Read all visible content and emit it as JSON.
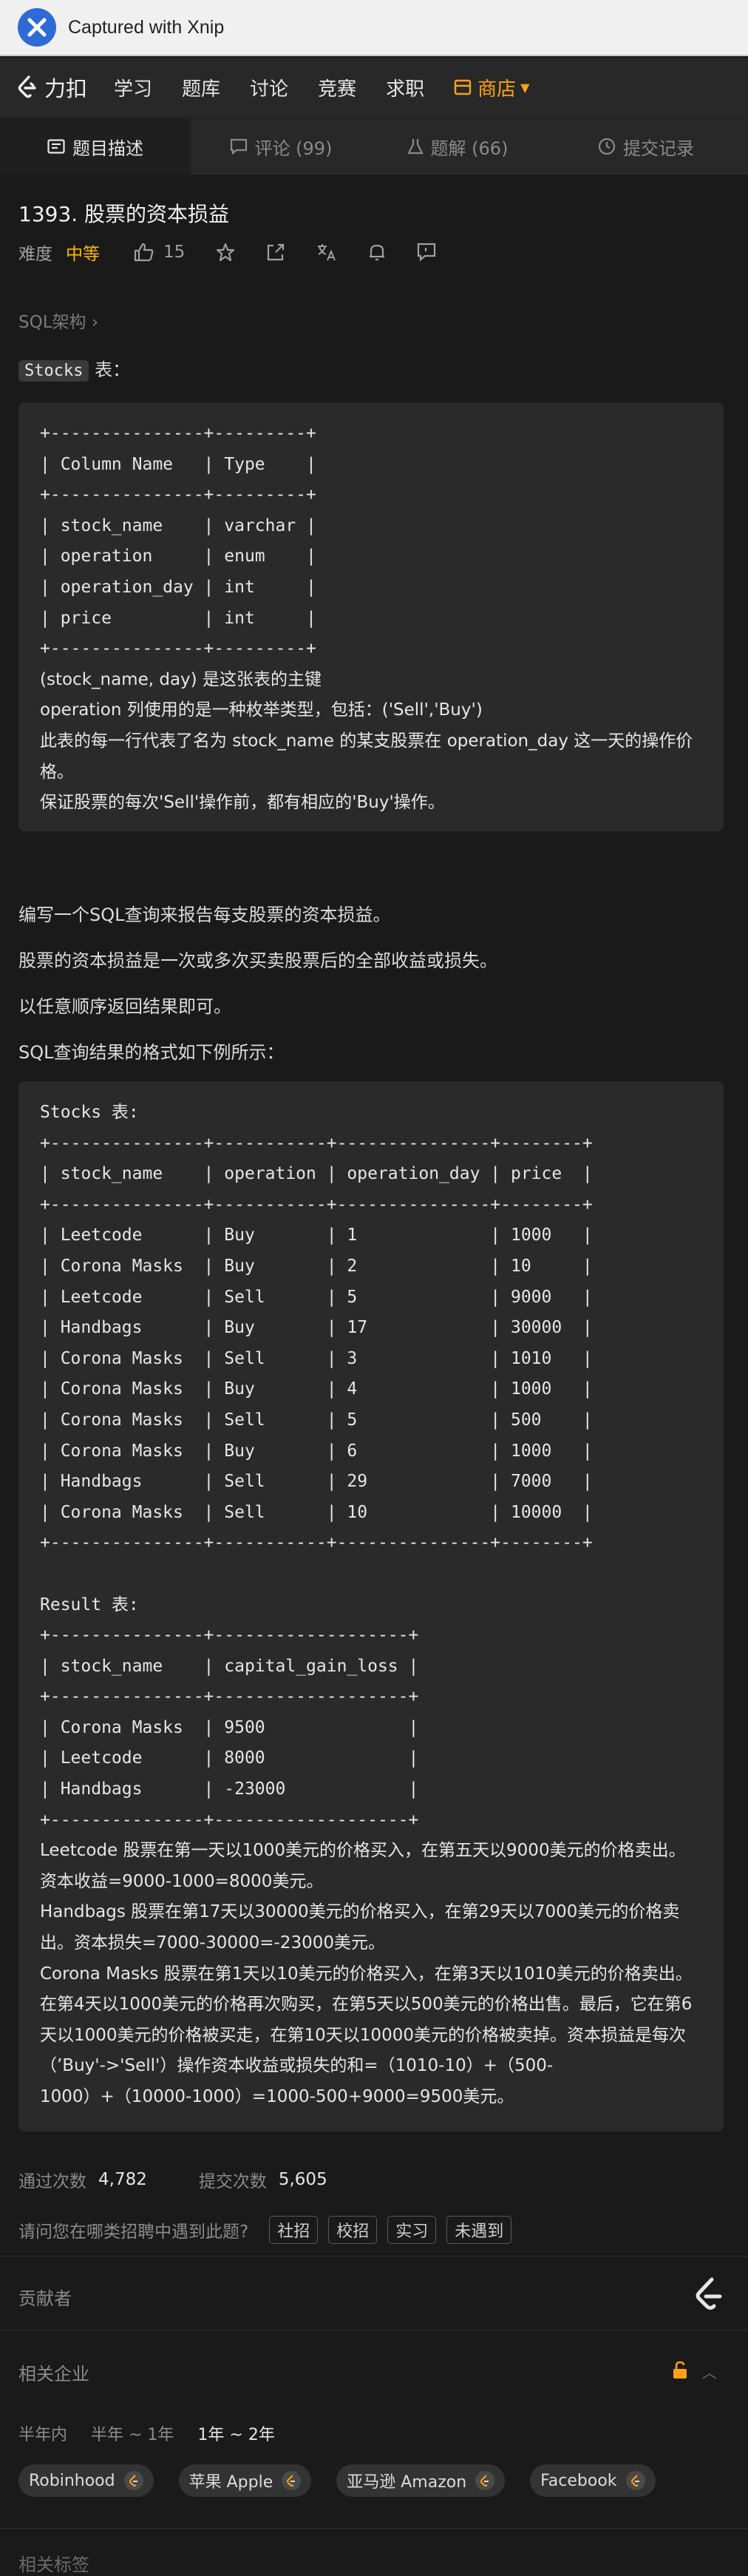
{
  "titlebar": {
    "title": "Captured with Xnip"
  },
  "nav": {
    "brand": "力扣",
    "items": [
      "学习",
      "题库",
      "讨论",
      "竞赛",
      "求职"
    ],
    "store": "商店"
  },
  "tabs": [
    {
      "label": "题目描述",
      "active": true
    },
    {
      "label": "评论 (99)",
      "active": false
    },
    {
      "label": "题解 (66)",
      "active": false
    },
    {
      "label": "提交记录",
      "active": false
    }
  ],
  "problem": {
    "title": "1393. 股票的资本损益",
    "difficulty_label": "难度",
    "difficulty": "中等",
    "likes": "15",
    "breadcrumb": "SQL架构 ›",
    "table_name": "Stocks",
    "table_suffix": " 表：",
    "schema_pre": "+---------------+---------+\n| Column Name   | Type    |\n+---------------+---------+\n| stock_name    | varchar |\n| operation     | enum    |\n| operation_day | int     |\n| price         | int     |\n+---------------+---------+",
    "schema_notes": [
      "(stock_name, day) 是这张表的主键",
      "operation 列使用的是一种枚举类型，包括：('Sell','Buy')",
      "此表的每一行代表了名为 stock_name 的某支股票在 operation_day 这一天的操作价格。",
      "保证股票的每次'Sell'操作前，都有相应的'Buy'操作。"
    ],
    "paragraphs": [
      "编写一个SQL查询来报告每支股票的资本损益。",
      "股票的资本损益是一次或多次买卖股票后的全部收益或损失。",
      "以任意顺序返回结果即可。",
      "SQL查询结果的格式如下例所示："
    ],
    "example_pre": "Stocks 表:\n+---------------+-----------+---------------+--------+\n| stock_name    | operation | operation_day | price  |\n+---------------+-----------+---------------+--------+\n| Leetcode      | Buy       | 1             | 1000   |\n| Corona Masks  | Buy       | 2             | 10     |\n| Leetcode      | Sell      | 5             | 9000   |\n| Handbags      | Buy       | 17            | 30000  |\n| Corona Masks  | Sell      | 3             | 1010   |\n| Corona Masks  | Buy       | 4             | 1000   |\n| Corona Masks  | Sell      | 5             | 500    |\n| Corona Masks  | Buy       | 6             | 1000   |\n| Handbags      | Sell      | 29            | 7000   |\n| Corona Masks  | Sell      | 10            | 10000  |\n+---------------+-----------+---------------+--------+\n\nResult 表:\n+---------------+-------------------+\n| stock_name    | capital_gain_loss |\n+---------------+-------------------+\n| Corona Masks  | 9500              |\n| Leetcode      | 8000              |\n| Handbags      | -23000            |\n+---------------+-------------------+",
    "example_notes": [
      "Leetcode 股票在第一天以1000美元的价格买入，在第五天以9000美元的价格卖出。资本收益=9000-1000=8000美元。",
      "Handbags 股票在第17天以30000美元的价格买入，在第29天以7000美元的价格卖出。资本损失=7000-30000=-23000美元。",
      "Corona Masks 股票在第1天以10美元的价格买入，在第3天以1010美元的价格卖出。在第4天以1000美元的价格再次购买，在第5天以500美元的价格出售。最后，它在第6天以1000美元的价格被买走，在第10天以10000美元的价格被卖掉。资本损益是每次（’Buy'->'Sell'）操作资本收益或损失的和=（1010-10）+（500-1000）+（10000-1000）=1000-500+9000=9500美元。"
    ]
  },
  "stats": {
    "passed_label": "通过次数",
    "passed": "4,782",
    "submitted_label": "提交次数",
    "submitted": "5,605"
  },
  "recruit": {
    "question": "请问您在哪类招聘中遇到此题?",
    "options": [
      "社招",
      "校招",
      "实习",
      "未遇到"
    ]
  },
  "contributors_label": "贡献者",
  "companies_section": {
    "label": "相关企业",
    "periods": [
      "半年内",
      "半年 ~ 1年",
      "1年 ~ 2年"
    ],
    "selected_period": "1年 ~ 2年",
    "companies": [
      "Robinhood",
      "苹果 Apple",
      "亚马逊 Amazon",
      "Facebook"
    ]
  },
  "tags_label": "相关标签",
  "colors": {
    "accent": "#ffa116",
    "medium": "#ffb800",
    "bg": "#1a1a1a",
    "panel": "#282828",
    "block": "#2a2a2a"
  }
}
